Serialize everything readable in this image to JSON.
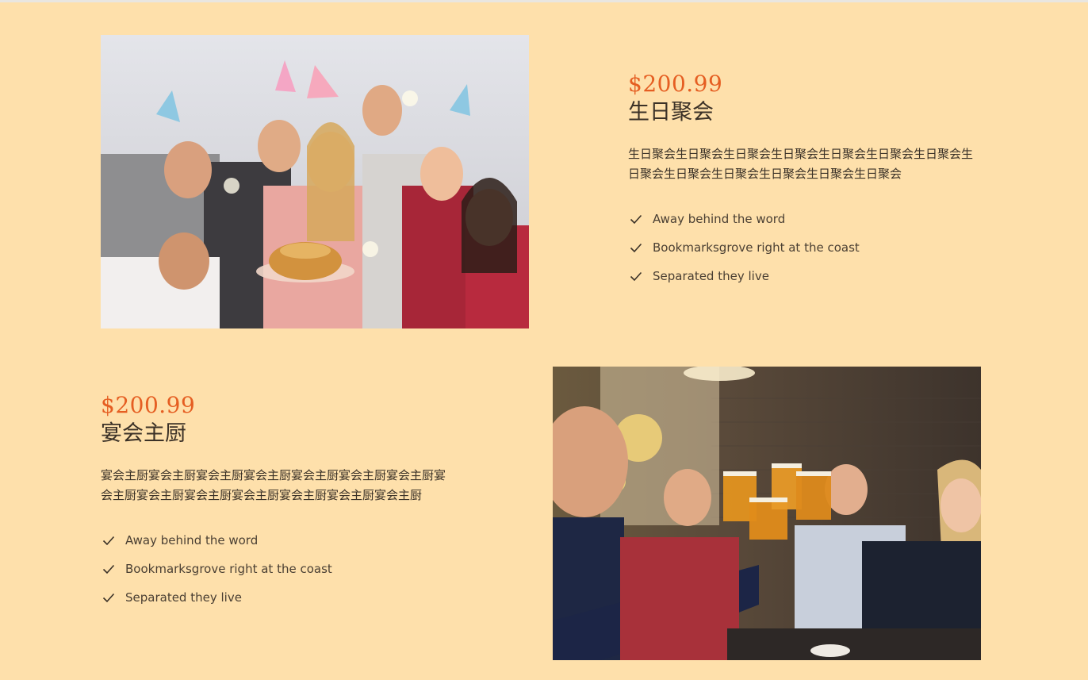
{
  "packages": [
    {
      "price": "$200.99",
      "title": "生日聚会",
      "description": "生日聚会生日聚会生日聚会生日聚会生日聚会生日聚会生日聚会生日聚会生日聚会生日聚会生日聚会生日聚会生日聚会",
      "features": [
        "Away behind the word",
        "Bookmarksgrove right at the coast",
        "Separated they live"
      ],
      "image_icon": "birthday-party-photo"
    },
    {
      "price": "$200.99",
      "title": "宴会主厨",
      "description": "宴会主厨宴会主厨宴会主厨宴会主厨宴会主厨宴会主厨宴会主厨宴会主厨宴会主厨宴会主厨宴会主厨宴会主厨宴会主厨宴会主厨",
      "features": [
        "Away behind the word",
        "Bookmarksgrove right at the coast",
        "Separated they live"
      ],
      "image_icon": "friends-toasting-beer-photo"
    }
  ],
  "colors": {
    "background": "#fee0ab",
    "price": "#e55e22",
    "text": "#3a3127"
  }
}
